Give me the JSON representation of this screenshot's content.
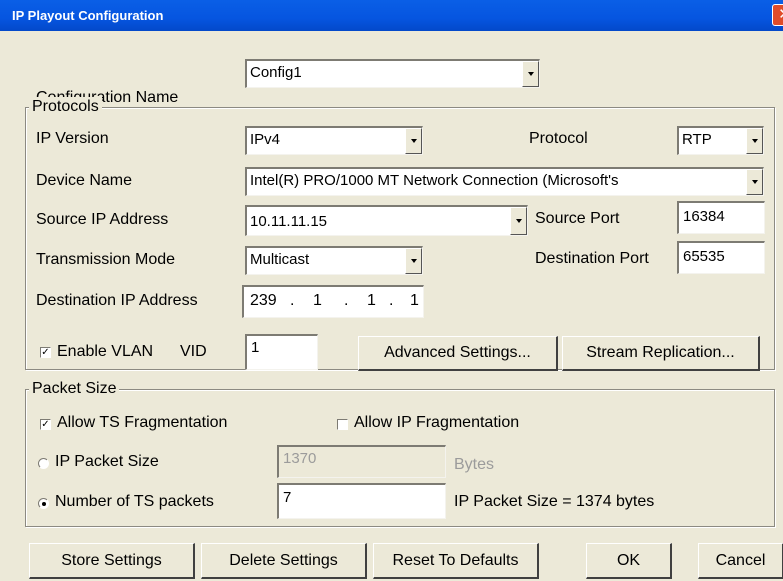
{
  "window": {
    "title": "IP Playout Configuration",
    "close_glyph": "✕"
  },
  "config": {
    "label": "Configuration Name",
    "value": "Config1"
  },
  "protocols": {
    "group_label": "Protocols",
    "ip_version": {
      "label": "IP Version",
      "value": "IPv4"
    },
    "protocol": {
      "label": "Protocol",
      "value": "RTP"
    },
    "device_name": {
      "label": "Device Name",
      "value": "Intel(R) PRO/1000 MT Network Connection (Microsoft's"
    },
    "source_ip": {
      "label": "Source IP Address",
      "value": "10.11.11.15"
    },
    "source_port": {
      "label": "Source Port",
      "value": "16384"
    },
    "transmission_mode": {
      "label": "Transmission Mode",
      "value": "Multicast"
    },
    "destination_port": {
      "label": "Destination Port",
      "value": "65535"
    },
    "destination_ip": {
      "label": "Destination IP Address",
      "octets": [
        "239",
        "1",
        "1",
        "1"
      ]
    },
    "enable_vlan": {
      "label": "Enable VLAN",
      "checked": true,
      "check_glyph": "✓"
    },
    "vid": {
      "label": "VID",
      "value": "1"
    },
    "advanced_button": "Advanced Settings...",
    "replication_button": "Stream Replication..."
  },
  "packet_size": {
    "group_label": "Packet Size",
    "allow_ts_frag": {
      "label": "Allow TS Fragmentation",
      "checked": true,
      "check_glyph": "✓"
    },
    "allow_ip_frag": {
      "label": "Allow IP Fragmentation",
      "checked": false
    },
    "ip_packet_size": {
      "label": "IP Packet Size",
      "value": "1370",
      "unit": "Bytes",
      "selected": false
    },
    "num_ts_packets": {
      "label": "Number of TS packets",
      "value": "7",
      "selected": true
    },
    "computed": "IP Packet Size =  1374 bytes"
  },
  "footer": {
    "store": "Store Settings",
    "delete": "Delete Settings",
    "reset": "Reset To Defaults",
    "ok": "OK",
    "cancel": "Cancel"
  }
}
